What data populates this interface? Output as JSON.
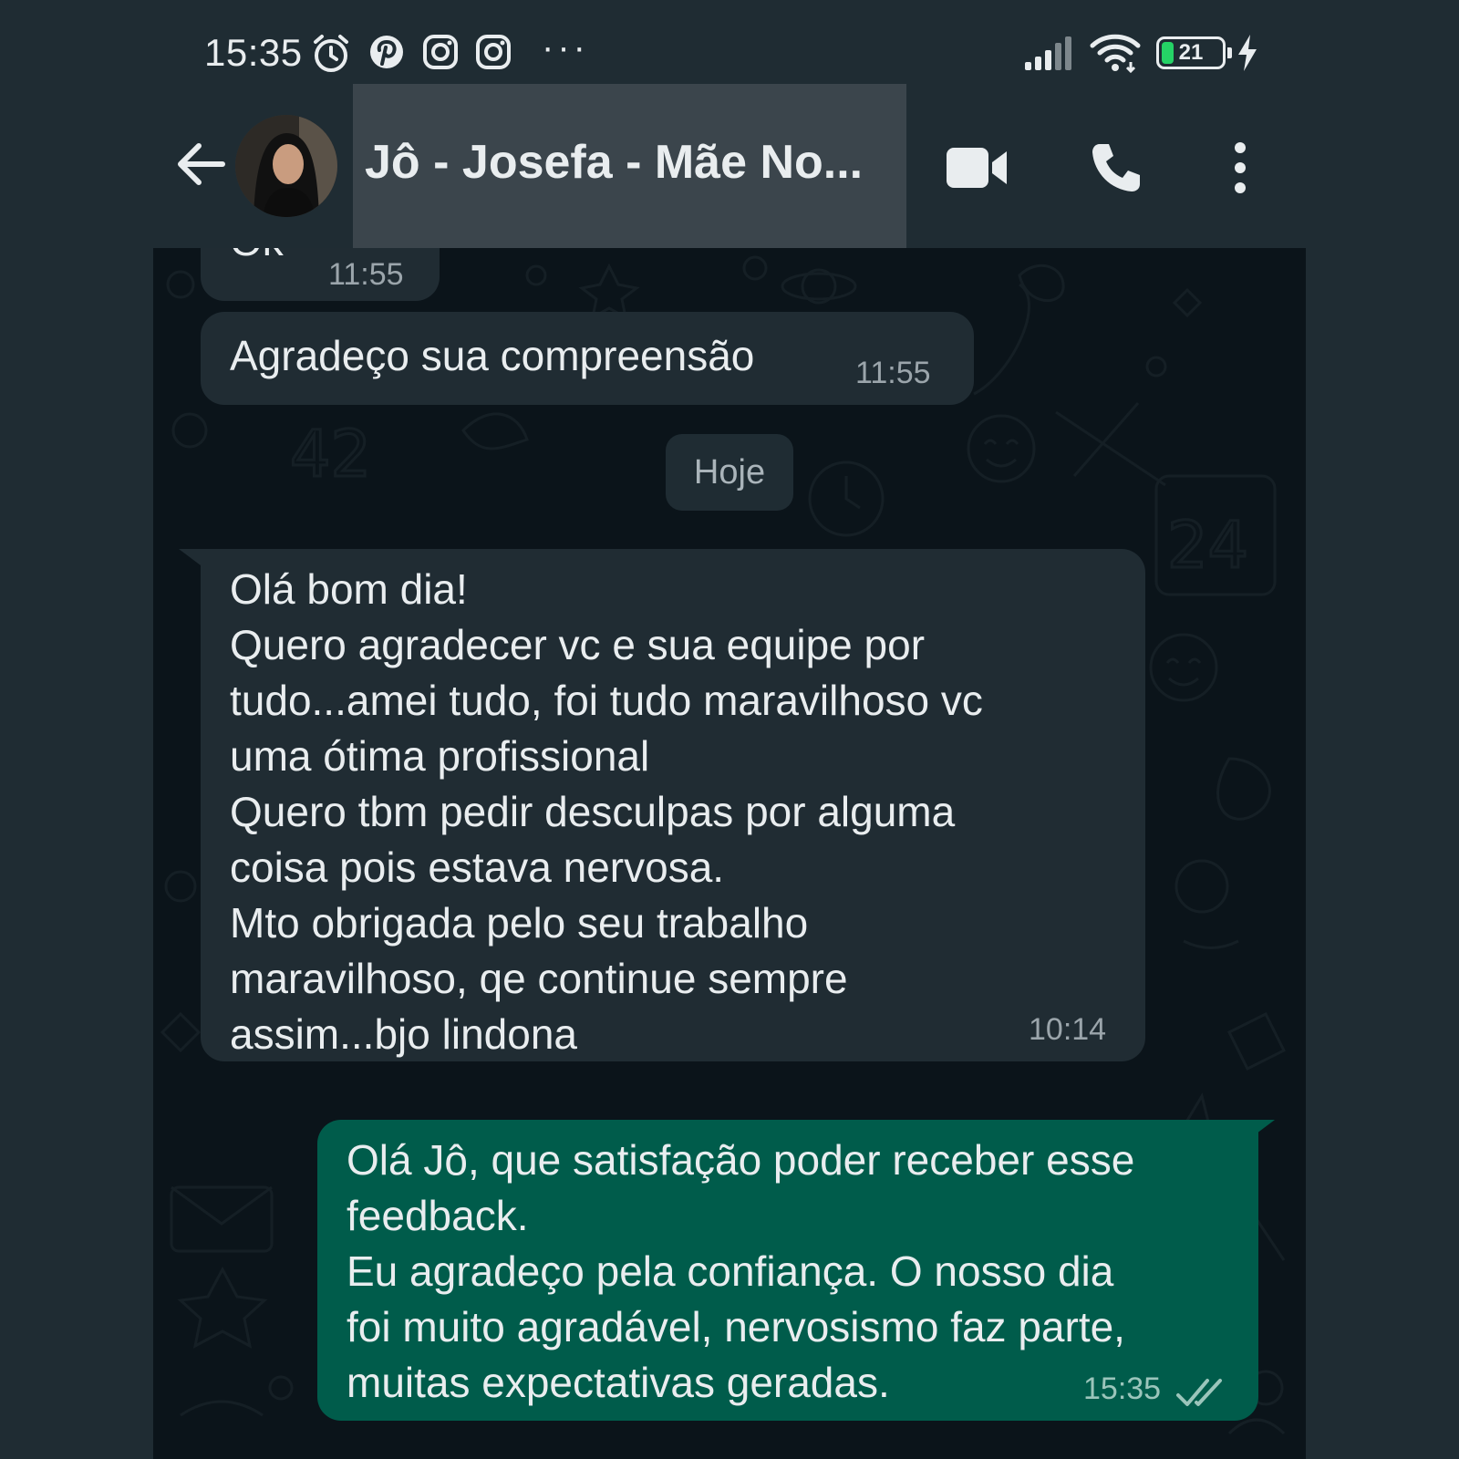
{
  "status_bar": {
    "time": "15:35",
    "notification_icons": [
      "alarm-icon",
      "pinterest-icon",
      "instagram-icon",
      "instagram-icon"
    ],
    "more": "···",
    "battery": "21",
    "battery_level_percent": 21,
    "charging": true
  },
  "header": {
    "contact_name": "Jô - Josefa - Mãe No...",
    "icons": [
      "back-arrow-icon",
      "video-call-icon",
      "voice-call-icon",
      "more-vert-icon"
    ]
  },
  "messages": [
    {
      "direction": "in",
      "text": "Ok",
      "time": "11:55"
    },
    {
      "direction": "in",
      "text": "Agradeço sua compreensão",
      "time": "11:55"
    },
    {
      "direction": "in",
      "text": "Olá bom dia!\nQuero agradecer vc e sua equipe por\ntudo...amei tudo, foi tudo maravilhoso vc\numa ótima profissional\nQuero tbm pedir desculpas por alguma\ncoisa pois estava nervosa.\nMto obrigada pelo seu trabalho\nmaravilhoso, qe continue sempre\nassim...bjo lindona",
      "time": "10:14"
    },
    {
      "direction": "out",
      "text": "Olá Jô, que satisfação poder receber esse\nfeedback.\nEu agradeço pela confiança. O nosso dia\nfoi muito agradável, nervosismo faz parte,\nmuitas expectativas geradas.",
      "time": "15:35",
      "status": "read-double-check-icon"
    }
  ],
  "date_divider": "Hoje",
  "colors": {
    "header_bg": "#1f2c33",
    "chat_bg": "#0b141a",
    "incoming_bubble": "#202c33",
    "outgoing_bubble": "#005c4b",
    "text": "#e9edef"
  }
}
